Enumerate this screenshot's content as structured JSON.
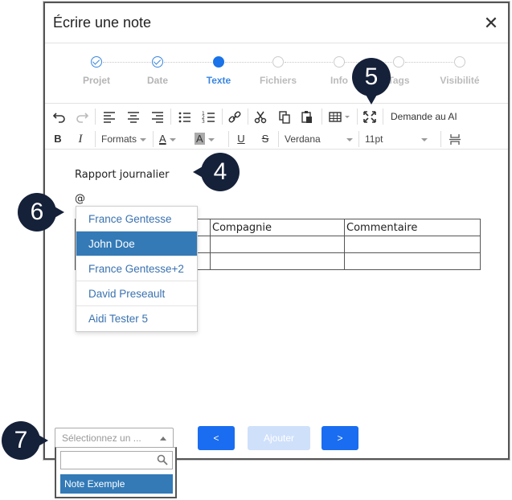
{
  "modal": {
    "title": "Écrire une note",
    "close_label": "✕"
  },
  "stepper": {
    "steps": [
      {
        "label": "Projet",
        "state": "done"
      },
      {
        "label": "Date",
        "state": "done"
      },
      {
        "label": "Texte",
        "state": "active"
      },
      {
        "label": "Fichiers",
        "state": "pending"
      },
      {
        "label": "Info",
        "state": "pending"
      },
      {
        "label": "Tags",
        "state": "pending"
      },
      {
        "label": "Visibilité",
        "state": "pending"
      }
    ]
  },
  "toolbar": {
    "ai_button": "Demande au AI",
    "formats_label": "Formats",
    "font_family": "Verdana",
    "font_size": "11pt",
    "bold_label": "B",
    "italic_label": "I",
    "underline_label": "U",
    "strike_label": "S",
    "font_color_label": "A",
    "bg_color_label": "A"
  },
  "editor": {
    "heading": "Rapport journalier",
    "at_char": "@",
    "table": {
      "headers": [
        "",
        "Compagnie",
        "Commentaire"
      ],
      "rows": [
        [
          "",
          "",
          ""
        ],
        [
          "",
          "",
          ""
        ]
      ]
    }
  },
  "mention_dropdown": {
    "items": [
      "France Gentesse",
      "John Doe",
      "France Gentesse+2",
      "David Preseault",
      "Aidi Tester 5"
    ],
    "selected_index": 1
  },
  "footer": {
    "prev_label": "<",
    "add_label": "Ajouter",
    "next_label": ">"
  },
  "note_select": {
    "placeholder": "Sélectionnez un ...",
    "options": [
      "Note Exemple"
    ]
  },
  "callouts": {
    "c4": "4",
    "c5": "5",
    "c6": "6",
    "c7": "7"
  },
  "colors": {
    "primary": "#1a6df0",
    "selected": "#337ab7",
    "callout": "#152139"
  }
}
